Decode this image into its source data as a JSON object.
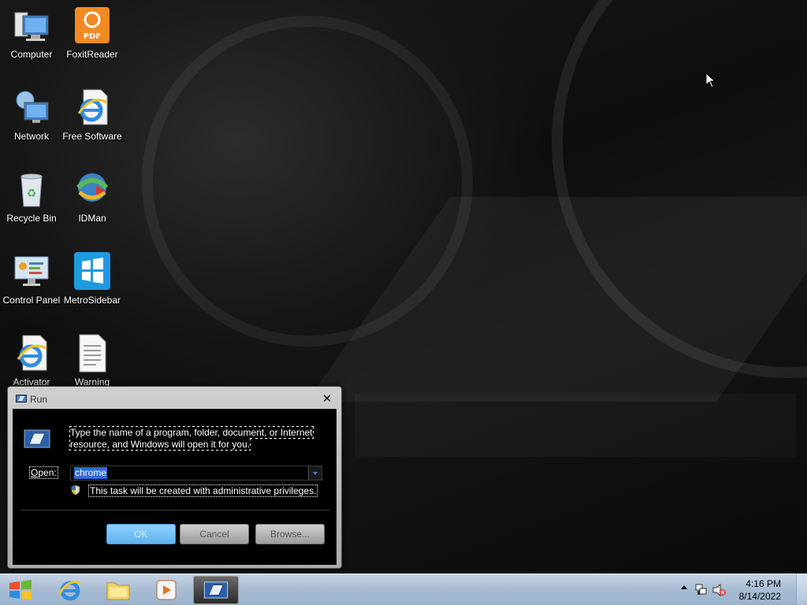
{
  "desktop": {
    "icons": [
      {
        "label": "Computer",
        "icon": "computer-icon"
      },
      {
        "label": "FoxitReader",
        "icon": "pdf-icon"
      },
      {
        "label": "Network",
        "icon": "network-icon"
      },
      {
        "label": "Free Software",
        "icon": "ie-icon"
      },
      {
        "label": "Recycle Bin",
        "icon": "recycle-bin-icon"
      },
      {
        "label": "IDMan",
        "icon": "idm-icon"
      },
      {
        "label": "Control Panel",
        "icon": "control-panel-icon"
      },
      {
        "label": "MetroSidebar",
        "icon": "metro-icon"
      },
      {
        "label": "Activator",
        "icon": "ie-icon"
      },
      {
        "label": "Warning",
        "icon": "text-file-icon"
      }
    ]
  },
  "run_dialog": {
    "title": "Run",
    "description": "Type the name of a program, folder, document, or Internet resource, and Windows will open it for you.",
    "open_label_prefix": "",
    "open_label_access": "O",
    "open_label_rest": "pen:",
    "open_value": "chrome",
    "admin_note": "This task will be created with administrative privileges.",
    "ok_label": "OK",
    "cancel_label": "Cancel",
    "browse_label": "Browse..."
  },
  "taskbar": {
    "pinned": [
      "ie-icon",
      "explorer-folder-icon",
      "media-player-icon",
      "run-icon"
    ],
    "clock_time": "4:16 PM",
    "clock_date": "8/14/2022"
  },
  "colors": {
    "selection": "#2d6bd6",
    "ok_button": "#5eb2ee",
    "taskbar": "#a9bdd4"
  }
}
